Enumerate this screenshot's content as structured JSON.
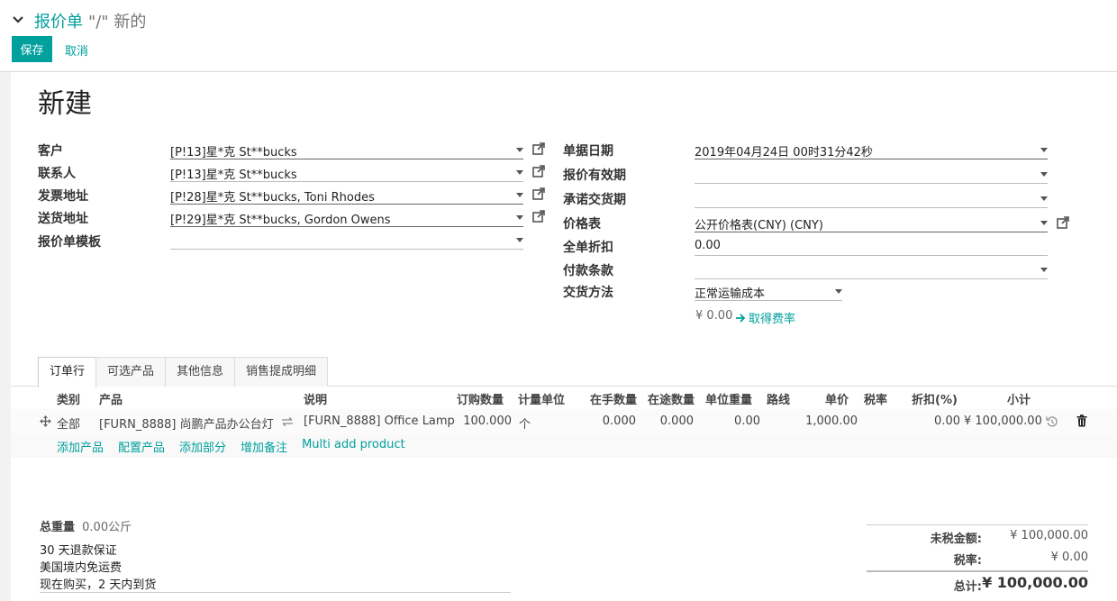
{
  "breadcrumb": {
    "parent": "报价单",
    "current": "\"/\" 新的"
  },
  "buttons": {
    "save": "保存",
    "cancel": "取消"
  },
  "title": "新建",
  "left_fields": [
    {
      "label": "客户",
      "value": "[P!13]星*克  St**bucks"
    },
    {
      "label": "联系人",
      "value": "[P!13]星*克  St**bucks"
    },
    {
      "label": "发票地址",
      "value": "[P!28]星*克  St**bucks, Toni Rhodes"
    },
    {
      "label": "送货地址",
      "value": "[P!29]星*克  St**bucks, Gordon Owens"
    },
    {
      "label": "报价单模板",
      "value": ""
    }
  ],
  "right_fields": [
    {
      "label": "单据日期",
      "value": "2019年04月24日 00时31分42秒"
    },
    {
      "label": "报价有效期",
      "value": ""
    },
    {
      "label": "承诺交货期",
      "value": ""
    },
    {
      "label": "价格表",
      "value": "公开价格表(CNY) (CNY)"
    },
    {
      "label": "全单折扣",
      "value": "0.00"
    },
    {
      "label": "付款条款",
      "value": ""
    },
    {
      "label": "交货方法",
      "value": "正常运输成本"
    }
  ],
  "shipping": {
    "amount": "¥ 0.00",
    "get_rate": "取得费率"
  },
  "tabs": [
    "订单行",
    "可选产品",
    "其他信息",
    "销售提成明细"
  ],
  "table": {
    "headers": [
      "类别",
      "产品",
      "说明",
      "订购数量",
      "计量单位",
      "在手数量",
      "在途数量",
      "单位重量",
      "路线",
      "单价",
      "税率",
      "折扣(%)",
      "小计"
    ],
    "row": {
      "category": "全部",
      "product": "[FURN_8888] 尚鹏产品办公台灯",
      "description": "[FURN_8888] Office Lamp",
      "qty": "100.000",
      "uom": "个",
      "on_hand": "0.000",
      "incoming": "0.000",
      "weight": "0.00",
      "route": "",
      "price": "1,000.00",
      "tax": "",
      "discount": "0.00",
      "subtotal": "¥ 100,000.00"
    },
    "add_links": [
      "添加产品",
      "配置产品",
      "添加部分",
      "增加备注",
      "Multi add product"
    ]
  },
  "total_weight": {
    "label": "总重量",
    "value": "0.00公斤"
  },
  "notes": [
    "30 天退款保证",
    "美国境内免运费",
    "现在购买，2 天内到货"
  ],
  "totals": {
    "untaxed_label": "未税金额:",
    "untaxed": "¥ 100,000.00",
    "tax_label": "税率:",
    "tax": "¥ 0.00",
    "total_label": "总计:",
    "total": "¥ 100,000.00"
  },
  "colors": {
    "accent": "#00A09D"
  }
}
